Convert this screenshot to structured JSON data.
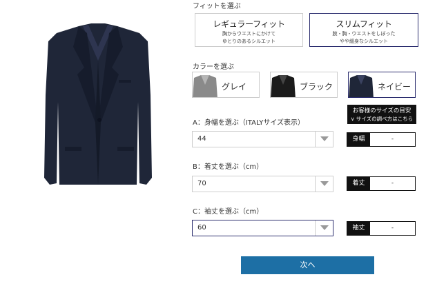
{
  "fit": {
    "heading": "フィットを選ぶ",
    "options": [
      {
        "title": "レギュラーフィット",
        "desc_line1": "胸からウエストにかけて",
        "desc_line2": "ゆとりのあるシルエット",
        "selected": false
      },
      {
        "title": "スリムフィット",
        "desc_line1": "腕・胸・ウエストをしぼった",
        "desc_line2": "やや細身なシルエット",
        "selected": true
      }
    ]
  },
  "color": {
    "heading": "カラーを選ぶ",
    "options": [
      {
        "label": "グレイ",
        "swatch": "#8a8a8a",
        "selected": false
      },
      {
        "label": "ブラック",
        "swatch": "#1b1b1b",
        "selected": false
      },
      {
        "label": "ネイビー",
        "swatch": "#1f2638",
        "selected": true
      }
    ]
  },
  "size_guide": {
    "line1": "お客様のサイズの目安",
    "line2": "∨ サイズの調べ方はこちら"
  },
  "fields": {
    "a": {
      "label": "A：身幅を選ぶ（ITALYサイズ表示）",
      "value": "44",
      "measure_label": "身幅",
      "measure_value": "-"
    },
    "b": {
      "label": "B：着丈を選ぶ（cm）",
      "value": "70",
      "measure_label": "着丈",
      "measure_value": "-"
    },
    "c": {
      "label": "C：袖丈を選ぶ（cm）",
      "value": "60",
      "measure_label": "袖丈",
      "measure_value": "-"
    }
  },
  "next_button": {
    "label": "次へ"
  },
  "colors": {
    "accent": "#1d6fa5",
    "selected_border": "#2b2d6e",
    "jacket": "#1f2638"
  }
}
